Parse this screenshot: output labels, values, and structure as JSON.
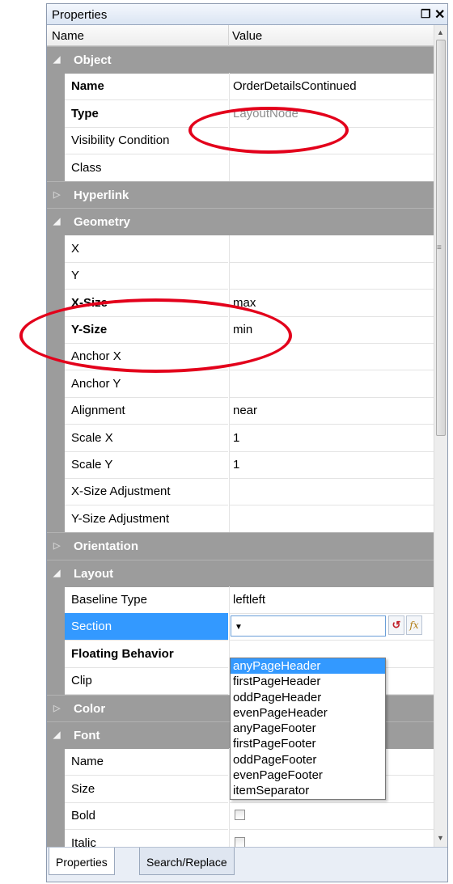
{
  "panel": {
    "title": "Properties",
    "pin_glyph": "❐",
    "close_glyph": "✕"
  },
  "columns": {
    "name": "Name",
    "value": "Value"
  },
  "rows": [
    {
      "kind": "cat",
      "label": "Object",
      "expanded": true
    },
    {
      "kind": "prop",
      "name": "Name",
      "value": "OrderDetailsContinued",
      "bold": true
    },
    {
      "kind": "prop",
      "name": "Type",
      "value": "LayoutNode",
      "bold": true,
      "value_grey": true
    },
    {
      "kind": "prop",
      "name": "Visibility Condition",
      "value": ""
    },
    {
      "kind": "prop",
      "name": "Class",
      "value": ""
    },
    {
      "kind": "cat",
      "label": "Hyperlink",
      "expanded": false
    },
    {
      "kind": "cat",
      "label": "Geometry",
      "expanded": true
    },
    {
      "kind": "prop",
      "name": "X",
      "value": ""
    },
    {
      "kind": "prop",
      "name": "Y",
      "value": ""
    },
    {
      "kind": "prop",
      "name": "X-Size",
      "value": "max",
      "bold": true
    },
    {
      "kind": "prop",
      "name": "Y-Size",
      "value": "min",
      "bold": true
    },
    {
      "kind": "prop",
      "name": "Anchor X",
      "value": ""
    },
    {
      "kind": "prop",
      "name": "Anchor Y",
      "value": ""
    },
    {
      "kind": "prop",
      "name": "Alignment",
      "value": "near"
    },
    {
      "kind": "prop",
      "name": "Scale X",
      "value": "1"
    },
    {
      "kind": "prop",
      "name": "Scale Y",
      "value": "1"
    },
    {
      "kind": "prop",
      "name": "X-Size Adjustment",
      "value": ""
    },
    {
      "kind": "prop",
      "name": "Y-Size Adjustment",
      "value": ""
    },
    {
      "kind": "cat",
      "label": "Orientation",
      "expanded": false
    },
    {
      "kind": "cat",
      "label": "Layout",
      "expanded": true
    },
    {
      "kind": "prop",
      "name": "Baseline Type",
      "value": "leftleft"
    },
    {
      "kind": "prop",
      "name": "Section",
      "value": "",
      "selected": true,
      "dropdown": true
    },
    {
      "kind": "prop",
      "name": "Floating Behavior",
      "value": "",
      "bold": true
    },
    {
      "kind": "prop",
      "name": "Clip",
      "value": ""
    },
    {
      "kind": "cat",
      "label": "Color",
      "expanded": false
    },
    {
      "kind": "cat",
      "label": "Font",
      "expanded": true
    },
    {
      "kind": "prop",
      "name": "Name",
      "value": ""
    },
    {
      "kind": "prop",
      "name": "Size",
      "value": ""
    },
    {
      "kind": "prop",
      "name": "Bold",
      "value": "",
      "checkbox": true
    },
    {
      "kind": "prop",
      "name": "Italic",
      "value": "",
      "checkbox": true
    }
  ],
  "section_dropdown": {
    "options": [
      "anyPageHeader",
      "firstPageHeader",
      "oddPageHeader",
      "evenPageHeader",
      "anyPageFooter",
      "firstPageFooter",
      "oddPageFooter",
      "evenPageFooter",
      "itemSeparator"
    ],
    "highlighted": "anyPageHeader",
    "reset_glyph": "↺",
    "fx_glyph": "fx"
  },
  "tabs": [
    {
      "label": "Properties",
      "active": true
    },
    {
      "label": "Search/Replace",
      "active": false
    }
  ],
  "annotation_color": "#e3001b",
  "icons": {
    "expanded": "expanded-triangle-icon",
    "collapsed": "collapsed-triangle-icon",
    "scroll_up": "scroll-up-arrow-icon",
    "scroll_down": "scroll-down-arrow-icon"
  }
}
